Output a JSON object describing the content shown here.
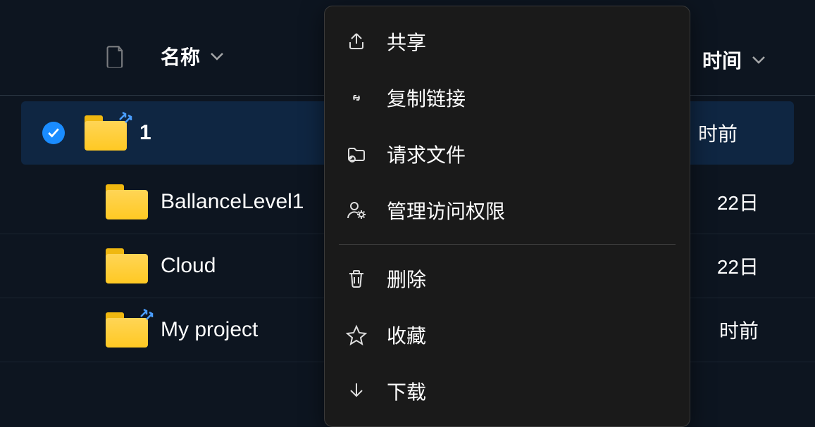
{
  "header": {
    "name_label": "名称",
    "time_label": "时间"
  },
  "files": [
    {
      "name": "1",
      "time": "时前",
      "shared": true,
      "selected": true
    },
    {
      "name": "BallanceLevel1",
      "time": "22日",
      "shared": false,
      "selected": false
    },
    {
      "name": "Cloud",
      "time": "22日",
      "shared": false,
      "selected": false
    },
    {
      "name": "My project",
      "time": "时前",
      "shared": true,
      "selected": false
    }
  ],
  "menu": {
    "share": "共享",
    "copy_link": "复制链接",
    "request_files": "请求文件",
    "manage_access": "管理访问权限",
    "delete": "删除",
    "favorite": "收藏",
    "download": "下载"
  }
}
